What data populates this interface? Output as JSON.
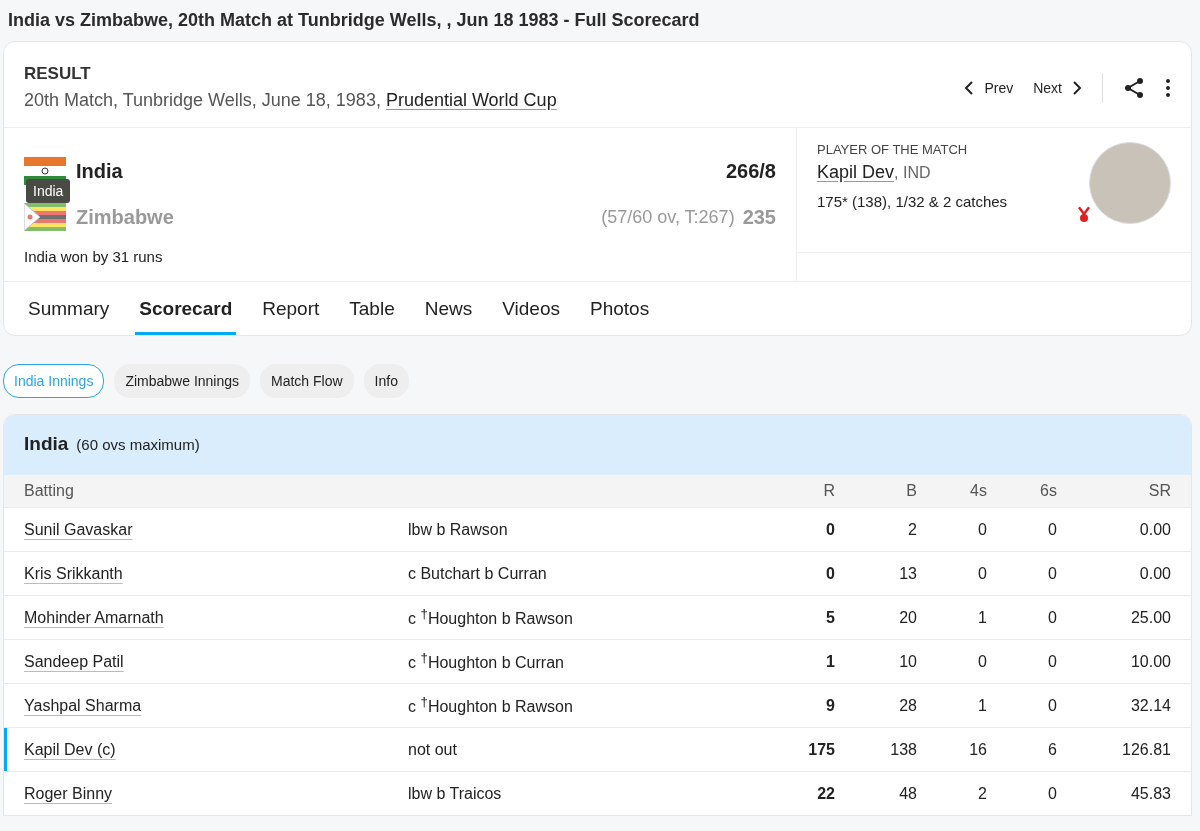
{
  "page_title": "India vs Zimbabwe, 20th Match at Tunbridge Wells, , Jun 18 1983 - Full Scorecard",
  "header": {
    "status": "RESULT",
    "details": "20th Match, Tunbridge Wells, June 18, 1983, ",
    "series_link": "Prudential World Cup",
    "prev": "Prev",
    "next": "Next"
  },
  "teams": [
    {
      "name": "India",
      "score": "266/8",
      "won": true,
      "kind": "india",
      "tooltip": "India"
    },
    {
      "name": "Zimbabwe",
      "score": "235",
      "overs": "(57/60 ov, T:267)",
      "won": false,
      "kind": "zimbabwe"
    }
  ],
  "result": "India won by 31 runs",
  "player_of_match": {
    "label": "PLAYER OF THE MATCH",
    "name": "Kapil Dev",
    "team": ", IND",
    "stats": "175* (138), 1/32 & 2 catches"
  },
  "tabs": [
    {
      "label": "Summary",
      "selected": false
    },
    {
      "label": "Scorecard",
      "selected": true
    },
    {
      "label": "Report",
      "selected": false
    },
    {
      "label": "Table",
      "selected": false
    },
    {
      "label": "News",
      "selected": false
    },
    {
      "label": "Videos",
      "selected": false
    },
    {
      "label": "Photos",
      "selected": false
    }
  ],
  "pills": [
    {
      "label": "India Innings",
      "selected": true
    },
    {
      "label": "Zimbabwe Innings",
      "selected": false
    },
    {
      "label": "Match Flow",
      "selected": false
    },
    {
      "label": "Info",
      "selected": false
    }
  ],
  "innings": {
    "team": "India",
    "note": "(60 ovs maximum)",
    "columns": [
      "Batting",
      "R",
      "B",
      "4s",
      "6s",
      "SR"
    ],
    "rows": [
      {
        "batter": "Sunil Gavaskar",
        "dismissal": "lbw b Rawson",
        "r": "0",
        "b": "2",
        "fours": "0",
        "sixes": "0",
        "sr": "0.00",
        "highlighted": false
      },
      {
        "batter": "Kris Srikkanth",
        "dismissal": "c Butchart b Curran",
        "r": "0",
        "b": "13",
        "fours": "0",
        "sixes": "0",
        "sr": "0.00",
        "highlighted": false
      },
      {
        "batter": "Mohinder Amarnath",
        "dismissal": "c $^{†}$Houghton b Rawson",
        "r": "5",
        "b": "20",
        "fours": "1",
        "sixes": "0",
        "sr": "25.00",
        "highlighted": false
      },
      {
        "batter": "Sandeep Patil",
        "dismissal": "c $^{†}$Houghton b Curran",
        "r": "1",
        "b": "10",
        "fours": "0",
        "sixes": "0",
        "sr": "10.00",
        "highlighted": false
      },
      {
        "batter": "Yashpal Sharma",
        "dismissal": "c $^{†}$Houghton b Rawson",
        "r": "9",
        "b": "28",
        "fours": "1",
        "sixes": "0",
        "sr": "32.14",
        "highlighted": false
      },
      {
        "batter": "Kapil Dev (c)",
        "dismissal": "not out",
        "r": "175",
        "b": "138",
        "fours": "16",
        "sixes": "6",
        "sr": "126.81",
        "highlighted": true
      },
      {
        "batter": "Roger Binny",
        "dismissal": "lbw b Traicos",
        "r": "22",
        "b": "48",
        "fours": "2",
        "sixes": "0",
        "sr": "45.83",
        "highlighted": false
      }
    ]
  }
}
